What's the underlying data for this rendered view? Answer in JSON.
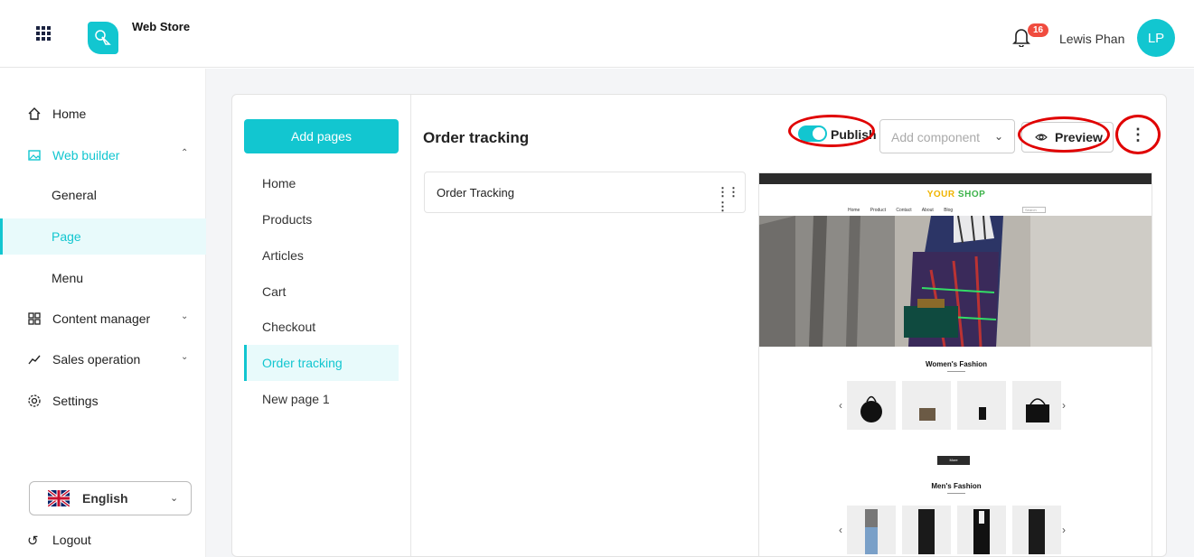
{
  "header": {
    "brand": "Web Store",
    "notification_count": "16",
    "user_name": "Lewis Phan",
    "avatar_initials": "LP"
  },
  "sidebar": {
    "items": [
      {
        "label": "Home",
        "icon": "home-icon"
      },
      {
        "label": "Web builder",
        "icon": "image-icon",
        "expanded": true
      },
      {
        "label": "General"
      },
      {
        "label": "Page",
        "active": true
      },
      {
        "label": "Menu"
      },
      {
        "label": "Content manager",
        "icon": "grid-icon"
      },
      {
        "label": "Sales operation",
        "icon": "trend-icon"
      },
      {
        "label": "Settings",
        "icon": "gear-icon"
      }
    ],
    "language": "English",
    "logout": "Logout"
  },
  "pages": {
    "add_label": "Add pages",
    "list": [
      "Home",
      "Products",
      "Articles",
      "Cart",
      "Checkout",
      "Order tracking",
      "New page 1"
    ],
    "active": "Order tracking"
  },
  "editor": {
    "title": "Order tracking",
    "publish_label": "Publish",
    "publish_on": true,
    "add_component_placeholder": "Add component",
    "preview_label": "Preview",
    "components": [
      "Order Tracking"
    ]
  },
  "site_preview": {
    "logo_a": "YOUR",
    "logo_b": "SHOP",
    "nav": [
      "Home",
      "Product",
      "Contact",
      "About",
      "Blog"
    ],
    "search_placeholder": "Search",
    "womens_title": "Women's Fashion",
    "mens_title": "Men's Fashion",
    "more_label": "More"
  },
  "colors": {
    "accent": "#12c6d0",
    "highlight": "#e00000",
    "badge": "#f04c3f"
  }
}
